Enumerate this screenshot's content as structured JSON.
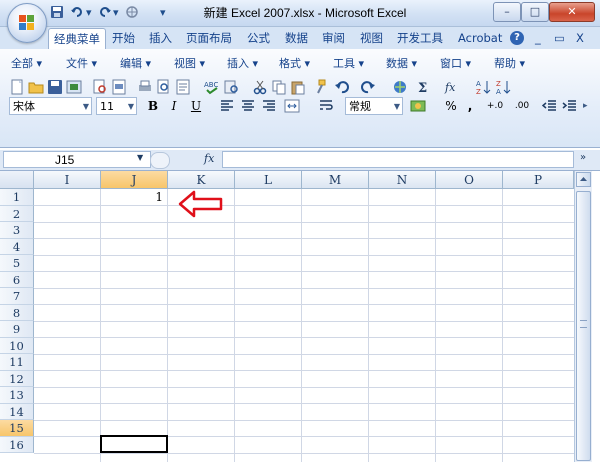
{
  "window": {
    "title": "新建 Excel 2007.xlsx - Microsoft Excel",
    "controls": {
      "minimize": "–",
      "maximize": "□",
      "close": "✕"
    }
  },
  "quick_access": {
    "save_icon": "save-icon",
    "undo_icon": "undo-icon",
    "redo_icon": "redo-icon",
    "customize": "▾"
  },
  "ribbon_tabs": [
    {
      "label": "经典菜单",
      "active": true
    },
    {
      "label": "开始"
    },
    {
      "label": "插入"
    },
    {
      "label": "页面布局"
    },
    {
      "label": "公式"
    },
    {
      "label": "数据"
    },
    {
      "label": "审阅"
    },
    {
      "label": "视图"
    },
    {
      "label": "开发工具"
    },
    {
      "label": "Acrobat"
    }
  ],
  "ribbon_right": {
    "help": "?",
    "minimize": "_",
    "restore": "▭",
    "close": "X"
  },
  "classic_menu": [
    {
      "label": "全部 ▾"
    },
    {
      "label": "文件 ▾"
    },
    {
      "label": "编辑 ▾"
    },
    {
      "label": "视图 ▾"
    },
    {
      "label": "插入 ▾"
    },
    {
      "label": "格式 ▾"
    },
    {
      "label": "工具 ▾"
    },
    {
      "label": "数据 ▾"
    },
    {
      "label": "窗口 ▾"
    },
    {
      "label": "帮助 ▾"
    }
  ],
  "format_bar": {
    "font_name": "宋体",
    "font_size": "11",
    "bold": "B",
    "italic": "I",
    "underline": "U",
    "number_format": "常规",
    "percent": "%",
    "comma": ",",
    "increase_decimal": "+.0",
    "decrease_decimal": ".00"
  },
  "formula_bar": {
    "name_box": "J15",
    "fx": "fx",
    "content": ""
  },
  "columns": [
    "I",
    "J",
    "K",
    "L",
    "M",
    "N",
    "O",
    "P"
  ],
  "selected_column": "J",
  "rows": [
    "1",
    "2",
    "3",
    "4",
    "5",
    "6",
    "7",
    "8",
    "9",
    "10",
    "11",
    "12",
    "13",
    "14",
    "15",
    "16"
  ],
  "selected_row": "15",
  "cells": {
    "J1": "1"
  },
  "colors": {
    "accent": "#15428b",
    "selection_header": "#f7c56a",
    "arrow": "#e0101a"
  }
}
